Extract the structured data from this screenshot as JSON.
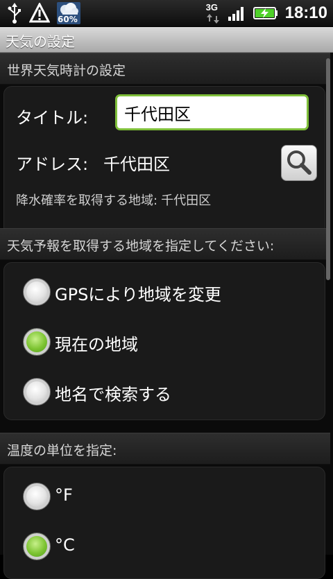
{
  "status": {
    "battery_text": "60%",
    "network": "3G",
    "time": "18:10"
  },
  "titlebar": {
    "title": "天気の設定"
  },
  "world_clock": {
    "header": "世界天気時計の設定",
    "title_label": "タイトル:",
    "title_value": "千代田区",
    "address_label": "アドレス:",
    "address_value": "千代田区",
    "precip_label": "降水確率を取得する地域:",
    "precip_value": "千代田区"
  },
  "region": {
    "header": "天気予報を取得する地域を指定してください:",
    "options": [
      {
        "label": "GPSにより地域を変更",
        "selected": false
      },
      {
        "label": "現在の地域",
        "selected": true
      },
      {
        "label": "地名で検索する",
        "selected": false
      }
    ]
  },
  "temp_unit": {
    "header": "温度の単位を指定:",
    "options": [
      {
        "label": "°F",
        "selected": false
      },
      {
        "label": "°C",
        "selected": true
      }
    ]
  },
  "colors": {
    "accent_green": "#7fbf3a"
  }
}
